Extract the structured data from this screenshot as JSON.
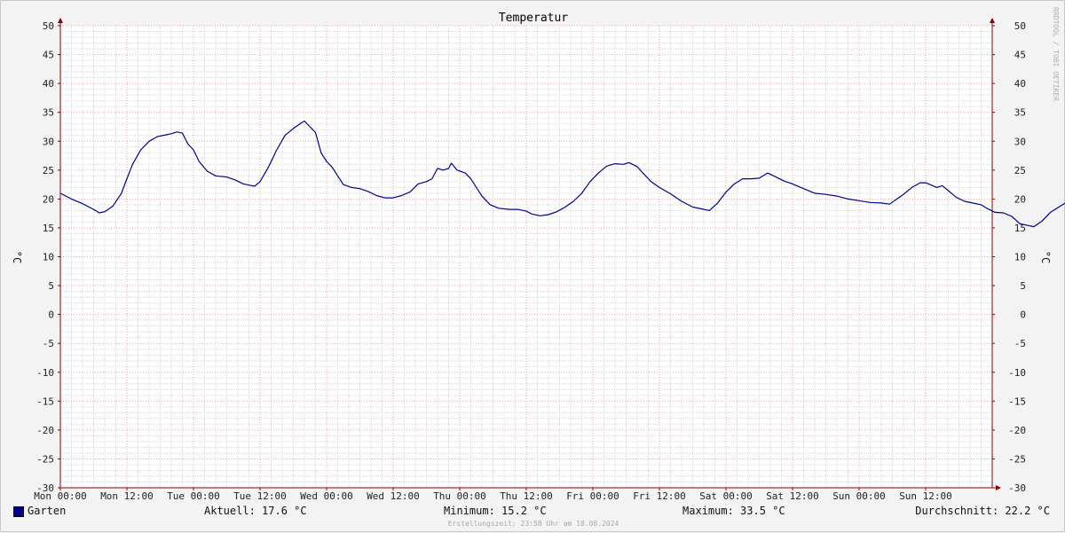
{
  "chart_data": {
    "type": "line",
    "title": "Temperatur",
    "ylabel": "°C",
    "ylim": [
      -30,
      50
    ],
    "yticks": [
      50,
      45,
      40,
      35,
      30,
      25,
      20,
      15,
      10,
      5,
      0,
      -5,
      -10,
      -15,
      -20,
      -25,
      -30
    ],
    "xlim": [
      0,
      168
    ],
    "xticks": [
      {
        "h": 0,
        "label": "Mon 00:00"
      },
      {
        "h": 12,
        "label": "Mon 12:00"
      },
      {
        "h": 24,
        "label": "Tue 00:00"
      },
      {
        "h": 36,
        "label": "Tue 12:00"
      },
      {
        "h": 48,
        "label": "Wed 00:00"
      },
      {
        "h": 60,
        "label": "Wed 12:00"
      },
      {
        "h": 72,
        "label": "Thu 00:00"
      },
      {
        "h": 84,
        "label": "Thu 12:00"
      },
      {
        "h": 96,
        "label": "Fri 00:00"
      },
      {
        "h": 108,
        "label": "Fri 12:00"
      },
      {
        "h": 120,
        "label": "Sat 00:00"
      },
      {
        "h": 132,
        "label": "Sat 12:00"
      },
      {
        "h": 144,
        "label": "Sun 00:00"
      },
      {
        "h": 156,
        "label": "Sun 12:00"
      }
    ],
    "grid": true,
    "series": [
      {
        "name": "Garten",
        "color": "#00008b",
        "points": [
          [
            0,
            21.0
          ],
          [
            2,
            20.0
          ],
          [
            4,
            19.2
          ],
          [
            6,
            18.2
          ],
          [
            7,
            17.6
          ],
          [
            8,
            17.8
          ],
          [
            9.5,
            18.8
          ],
          [
            11,
            21.0
          ],
          [
            12,
            23.5
          ],
          [
            13,
            26.0
          ],
          [
            14.5,
            28.5
          ],
          [
            16,
            30.0
          ],
          [
            17.5,
            30.8
          ],
          [
            19,
            31.1
          ],
          [
            20,
            31.3
          ],
          [
            21,
            31.6
          ],
          [
            22,
            31.4
          ],
          [
            23,
            29.5
          ],
          [
            24,
            28.5
          ],
          [
            25,
            26.5
          ],
          [
            26.5,
            24.8
          ],
          [
            28,
            24.0
          ],
          [
            30,
            23.8
          ],
          [
            31.5,
            23.3
          ],
          [
            33,
            22.6
          ],
          [
            34,
            22.4
          ],
          [
            35,
            22.2
          ],
          [
            36,
            23.0
          ],
          [
            37.5,
            25.5
          ],
          [
            39,
            28.5
          ],
          [
            40.5,
            31.0
          ],
          [
            42,
            32.2
          ],
          [
            43.5,
            33.2
          ],
          [
            44,
            33.5
          ],
          [
            45,
            32.5
          ],
          [
            46,
            31.5
          ],
          [
            47,
            28.0
          ],
          [
            48,
            26.5
          ],
          [
            49,
            25.5
          ],
          [
            50,
            24.0
          ],
          [
            51,
            22.5
          ],
          [
            52.5,
            22.0
          ],
          [
            54,
            21.8
          ],
          [
            55.5,
            21.3
          ],
          [
            57,
            20.6
          ],
          [
            58.5,
            20.2
          ],
          [
            60,
            20.2
          ],
          [
            61.5,
            20.6
          ],
          [
            63,
            21.2
          ],
          [
            64.5,
            22.6
          ],
          [
            66,
            23.0
          ],
          [
            67,
            23.5
          ],
          [
            68,
            25.3
          ],
          [
            69,
            25.0
          ],
          [
            70,
            25.3
          ],
          [
            70.5,
            26.2
          ],
          [
            71.5,
            25.0
          ],
          [
            73,
            24.5
          ],
          [
            74,
            23.5
          ],
          [
            75,
            22.0
          ],
          [
            76,
            20.5
          ],
          [
            77.5,
            19.0
          ],
          [
            79,
            18.4
          ],
          [
            81,
            18.2
          ],
          [
            82.5,
            18.2
          ],
          [
            84,
            17.9
          ],
          [
            85,
            17.4
          ],
          [
            86.5,
            17.1
          ],
          [
            88,
            17.3
          ],
          [
            89.5,
            17.8
          ],
          [
            91,
            18.6
          ],
          [
            92.5,
            19.6
          ],
          [
            94,
            21.0
          ],
          [
            95.5,
            23.0
          ],
          [
            97,
            24.5
          ],
          [
            98.5,
            25.7
          ],
          [
            100,
            26.1
          ],
          [
            101.5,
            26.0
          ],
          [
            102.5,
            26.3
          ],
          [
            104,
            25.6
          ],
          [
            105,
            24.5
          ],
          [
            106.5,
            23.0
          ],
          [
            108,
            22.0
          ],
          [
            110,
            20.9
          ],
          [
            112,
            19.6
          ],
          [
            114,
            18.6
          ],
          [
            115.5,
            18.3
          ],
          [
            117,
            18.0
          ],
          [
            118.5,
            19.3
          ],
          [
            120,
            21.2
          ],
          [
            121.5,
            22.6
          ],
          [
            123,
            23.5
          ],
          [
            124.5,
            23.5
          ],
          [
            126,
            23.6
          ],
          [
            127.5,
            24.5
          ],
          [
            129,
            23.8
          ],
          [
            130.5,
            23.1
          ],
          [
            132,
            22.6
          ],
          [
            134,
            21.8
          ],
          [
            136,
            21.0
          ],
          [
            138,
            20.8
          ],
          [
            140,
            20.5
          ],
          [
            142,
            20.0
          ],
          [
            144,
            19.7
          ],
          [
            146,
            19.4
          ],
          [
            148,
            19.3
          ],
          [
            149.5,
            19.1
          ],
          [
            150.5,
            19.8
          ],
          [
            152,
            20.8
          ],
          [
            153.5,
            22.0
          ],
          [
            155,
            22.8
          ],
          [
            156,
            22.8
          ],
          [
            157,
            22.4
          ],
          [
            158,
            22.0
          ],
          [
            159,
            22.3
          ],
          [
            160,
            21.5
          ],
          [
            161.5,
            20.3
          ],
          [
            163,
            19.6
          ],
          [
            164.5,
            19.3
          ],
          [
            166,
            19.0
          ],
          [
            167,
            18.4
          ],
          [
            168.5,
            17.7
          ],
          [
            170,
            17.6
          ],
          [
            171.5,
            17.0
          ],
          [
            173,
            15.7
          ],
          [
            174.5,
            15.4
          ],
          [
            175.5,
            15.2
          ],
          [
            177,
            16.2
          ],
          [
            178.5,
            17.7
          ],
          [
            180,
            18.6
          ],
          [
            181.5,
            19.5
          ],
          [
            183,
            20.0
          ],
          [
            184.5,
            20.5
          ],
          [
            186,
            20.8
          ],
          [
            187.5,
            20.5
          ],
          [
            189,
            19.5
          ],
          [
            190.5,
            18.2
          ],
          [
            192,
            17.9
          ],
          [
            192.5,
            17.6
          ]
        ]
      }
    ],
    "vertical_label": "RRDTOOL / TOBI OETIKER"
  },
  "footer": {
    "legend_name": "Garten",
    "current": "Aktuell: 17.6 °C",
    "minimum": "Minimum: 15.2 °C",
    "maximum": "Maximum: 33.5 °C",
    "average": "Durchschnitt: 22.2 °C",
    "created": "Erstellungszeit: 23:58 Uhr am 18.08.2024"
  },
  "colors": {
    "series": "#00008b",
    "grid_minor": "#d8d8d8",
    "grid_major": "#f0a0a0",
    "axis": "#8b0000",
    "plot_bg": "#ffffff",
    "page_bg": "#f3f3f3"
  }
}
